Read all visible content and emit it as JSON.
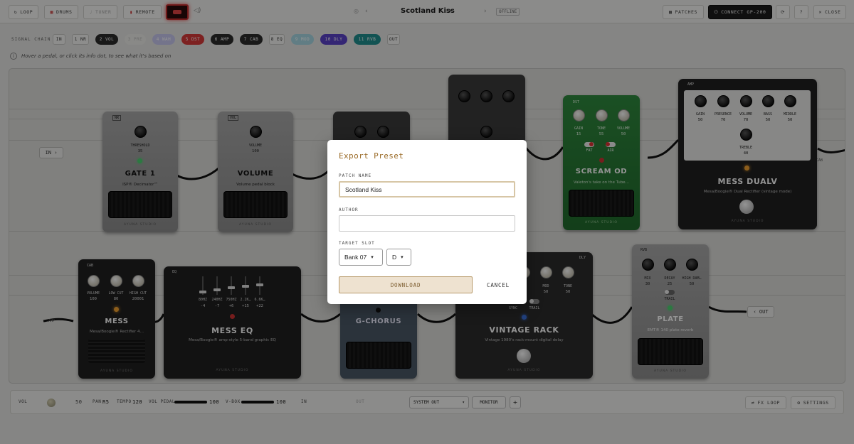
{
  "topbar": {
    "loop": "LOOP",
    "drums": "DRUMS",
    "tuner": "TUNER",
    "remote": "REMOTE",
    "title": "Scotland Kiss",
    "status": "OFFLINE",
    "patches": "PATCHES",
    "connect": "CONNECT GP-200",
    "close": "CLOSE"
  },
  "chain": {
    "label": "SIGNAL CHAIN",
    "items": [
      {
        "label": "IN",
        "color": "#f3f3f1",
        "text": "#333"
      },
      {
        "label": "1 NR",
        "color": "#f3f3f1",
        "text": "#333"
      },
      {
        "label": "2 VOL",
        "color": "#2b2b2b",
        "text": "#fff"
      },
      {
        "label": "3 PRE",
        "color": "#ecece9",
        "text": "#bbb"
      },
      {
        "label": "4 WAH",
        "color": "#c9c9f0",
        "text": "#fff"
      },
      {
        "label": "5 DST",
        "color": "#d83a3a",
        "text": "#fff"
      },
      {
        "label": "6 AMP",
        "color": "#2b2b2b",
        "text": "#fff"
      },
      {
        "label": "7 CAB",
        "color": "#2b2b2b",
        "text": "#fff"
      },
      {
        "label": "8 EQ",
        "color": "#f3f3f1",
        "text": "#333"
      },
      {
        "label": "9 MOD",
        "color": "#a7d8e4",
        "text": "#fff"
      },
      {
        "label": "10 DLY",
        "color": "#5b43c9",
        "text": "#fff"
      },
      {
        "label": "11 RVB",
        "color": "#1f8f8f",
        "text": "#fff"
      },
      {
        "label": "OUT",
        "color": "#f3f3f1",
        "text": "#333"
      }
    ]
  },
  "hint": "Hover a pedal, or click its info dot, to see what it's based on",
  "board": {
    "in_label": "IN",
    "out_label": "OUT",
    "amp_label": "AMP",
    "cab_label": "CAB",
    "gate": {
      "tag": "NR",
      "title": "GATE 1",
      "desc": "ISP® Decimator™",
      "knob_label": "THRESHOLD",
      "knob_value": "35",
      "brand": "AYUNA STUDIO"
    },
    "volume": {
      "tag": "VOL",
      "title": "VOLUME",
      "desc": "Volume pedal block",
      "knob_label": "VOLUME",
      "knob_value": "100",
      "brand": "AYUNA STUDIO"
    },
    "scream": {
      "tag": "DST",
      "title": "SCREAM OD",
      "desc": "Valeton's take on the Tube…",
      "knobs": [
        {
          "label": "GAIN",
          "value": "15"
        },
        {
          "label": "TONE",
          "value": "55"
        },
        {
          "label": "VOLUME",
          "value": "50"
        }
      ],
      "sw1": "FAT",
      "sw2": "AIR",
      "brand": "AYUNA STUDIO"
    },
    "amp": {
      "tag": "AMP",
      "title": "MESS DUALV",
      "desc": "Mesa/Boogie® Dual Rectifier (vintage mode)",
      "knobs": [
        {
          "label": "GAIN",
          "value": "50"
        },
        {
          "label": "PRESENCE",
          "value": "70"
        },
        {
          "label": "VOLUME",
          "value": "70"
        },
        {
          "label": "BASS",
          "value": "50"
        },
        {
          "label": "MIDDLE",
          "value": "50"
        }
      ],
      "treble_label": "TREBLE",
      "treble_value": "40",
      "brand": "AYUNA STUDIO"
    },
    "cab": {
      "tag": "CAB",
      "title": "MESS",
      "desc": "Mesa/Boogie® Rectifier 4…",
      "knobs": [
        {
          "label": "VOLUME",
          "value": "100"
        },
        {
          "label": "LOW CUT",
          "value": "80"
        },
        {
          "label": "HIGH CUT",
          "value": "20001"
        }
      ],
      "brand": "AYUNA STUDIO"
    },
    "eq": {
      "tag": "EQ",
      "title": "MESS EQ",
      "desc": "Mesa/Boogie® amp-style 5-band graphic EQ",
      "bands": [
        {
          "label": "80HZ",
          "value": "-4"
        },
        {
          "label": "240HZ",
          "value": "-7"
        },
        {
          "label": "750HZ",
          "value": "+6"
        },
        {
          "label": "2.2K…",
          "value": "+15"
        },
        {
          "label": "6.6K…",
          "value": "+22"
        }
      ],
      "brand": "AYUNA STUDIO"
    },
    "chorus": {
      "title": "G-CHORUS"
    },
    "rack": {
      "tag": "DLY",
      "title": "VINTAGE RACK",
      "desc": "Vintage 1980's rack-mount digital delay",
      "knobs": [
        {
          "label": "FEEDBACK",
          "value": ""
        },
        {
          "label": "MOD",
          "value": "50"
        },
        {
          "label": "TONE",
          "value": "50"
        }
      ],
      "sync": "SYNC",
      "trail": "TRAIL",
      "brand": "AYUNA STUDIO"
    },
    "plate": {
      "tag": "RVB",
      "title": "PLATE",
      "desc": "EMT® 140 plate reverb",
      "knobs": [
        {
          "label": "MIX",
          "value": "30"
        },
        {
          "label": "DECAY",
          "value": "25"
        },
        {
          "label": "HIGH DAM…",
          "value": "50"
        }
      ],
      "trail": "TRAIL",
      "brand": "AYUNA STUDIO"
    }
  },
  "modal": {
    "title": "Export Preset",
    "patch_label": "PATCH NAME",
    "patch_value": "Scotland Kiss",
    "author_label": "AUTHOR",
    "author_value": "",
    "slot_label": "TARGET SLOT",
    "bank_value": "Bank 07",
    "slot_value": "D",
    "download": "DOWNLOAD",
    "cancel": "CANCEL"
  },
  "bottom": {
    "vol_label": "VOL",
    "vol_value": "50",
    "pan_label": "PAN",
    "pan_value": "R5",
    "tempo_label": "TEMPO",
    "tempo_value": "120",
    "volpedal_label": "VOL PEDAL",
    "volpedal_value": "100",
    "vbox_label": "V-BOX",
    "vbox_value": "100",
    "in_label": "IN",
    "out_label": "OUT",
    "system_out": "SYSTEM OUT",
    "monitor": "MONITOR",
    "fxloop": "FX LOOP",
    "settings": "SETTINGS"
  }
}
